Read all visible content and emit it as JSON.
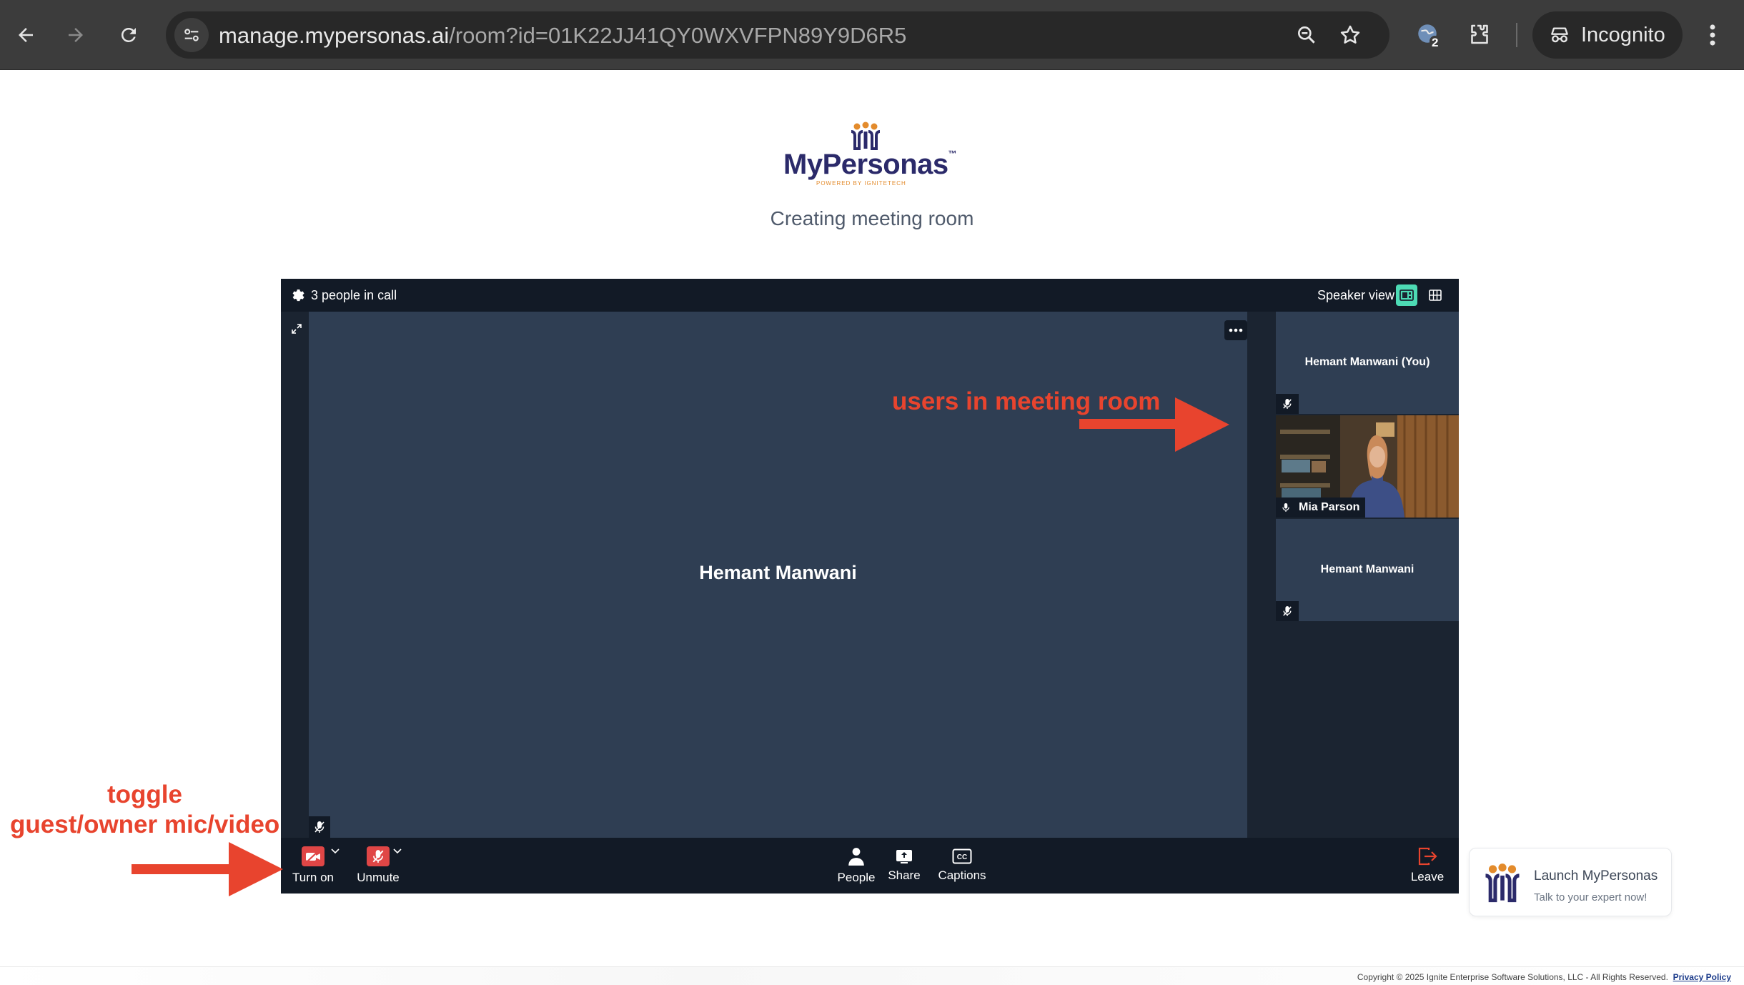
{
  "browser": {
    "url_host": "manage.mypersonas.ai",
    "url_path": "/room?id=01K22JJ41QY0WXVFPN89Y9D6R5",
    "incognito_label": "Incognito",
    "extension_badge": "2"
  },
  "page": {
    "logo_text": "MyPersonas",
    "logo_tm": "™",
    "logo_tagline": "POWERED BY IGNITETECH",
    "status_title": "Creating meeting room"
  },
  "call": {
    "people_count_label": "3 people in call",
    "view_label": "Speaker view",
    "main_speaker": "Hemant Manwani",
    "participants": [
      {
        "name": "Hemant Manwani (You)",
        "mic": "muted"
      },
      {
        "name": "Mia Parson",
        "mic": "on"
      },
      {
        "name": "Hemant Manwani",
        "mic": "muted"
      }
    ],
    "controls": {
      "camera_label": "Turn on",
      "mic_label": "Unmute",
      "people_label": "People",
      "share_label": "Share",
      "captions_label": "Captions",
      "leave_label": "Leave"
    }
  },
  "annotations": {
    "users_label": "users in meeting room",
    "toggle_line1": "toggle",
    "toggle_line2": "guest/owner mic/video"
  },
  "launch_card": {
    "title": "Launch MyPersonas",
    "subtitle": "Talk to your expert now!"
  },
  "footer": {
    "copyright": "Copyright © 2025 Ignite Enterprise Software Solutions, LLC - All Rights Reserved.",
    "privacy_link": "Privacy Policy"
  },
  "colors": {
    "accent_red": "#e8442e",
    "control_red": "#e04646",
    "tile_bg": "#2f3e53",
    "call_bg": "#1b2431",
    "active_view": "#4ddbb5",
    "brand_navy": "#2b2a6a",
    "brand_orange": "#e38b2c"
  }
}
